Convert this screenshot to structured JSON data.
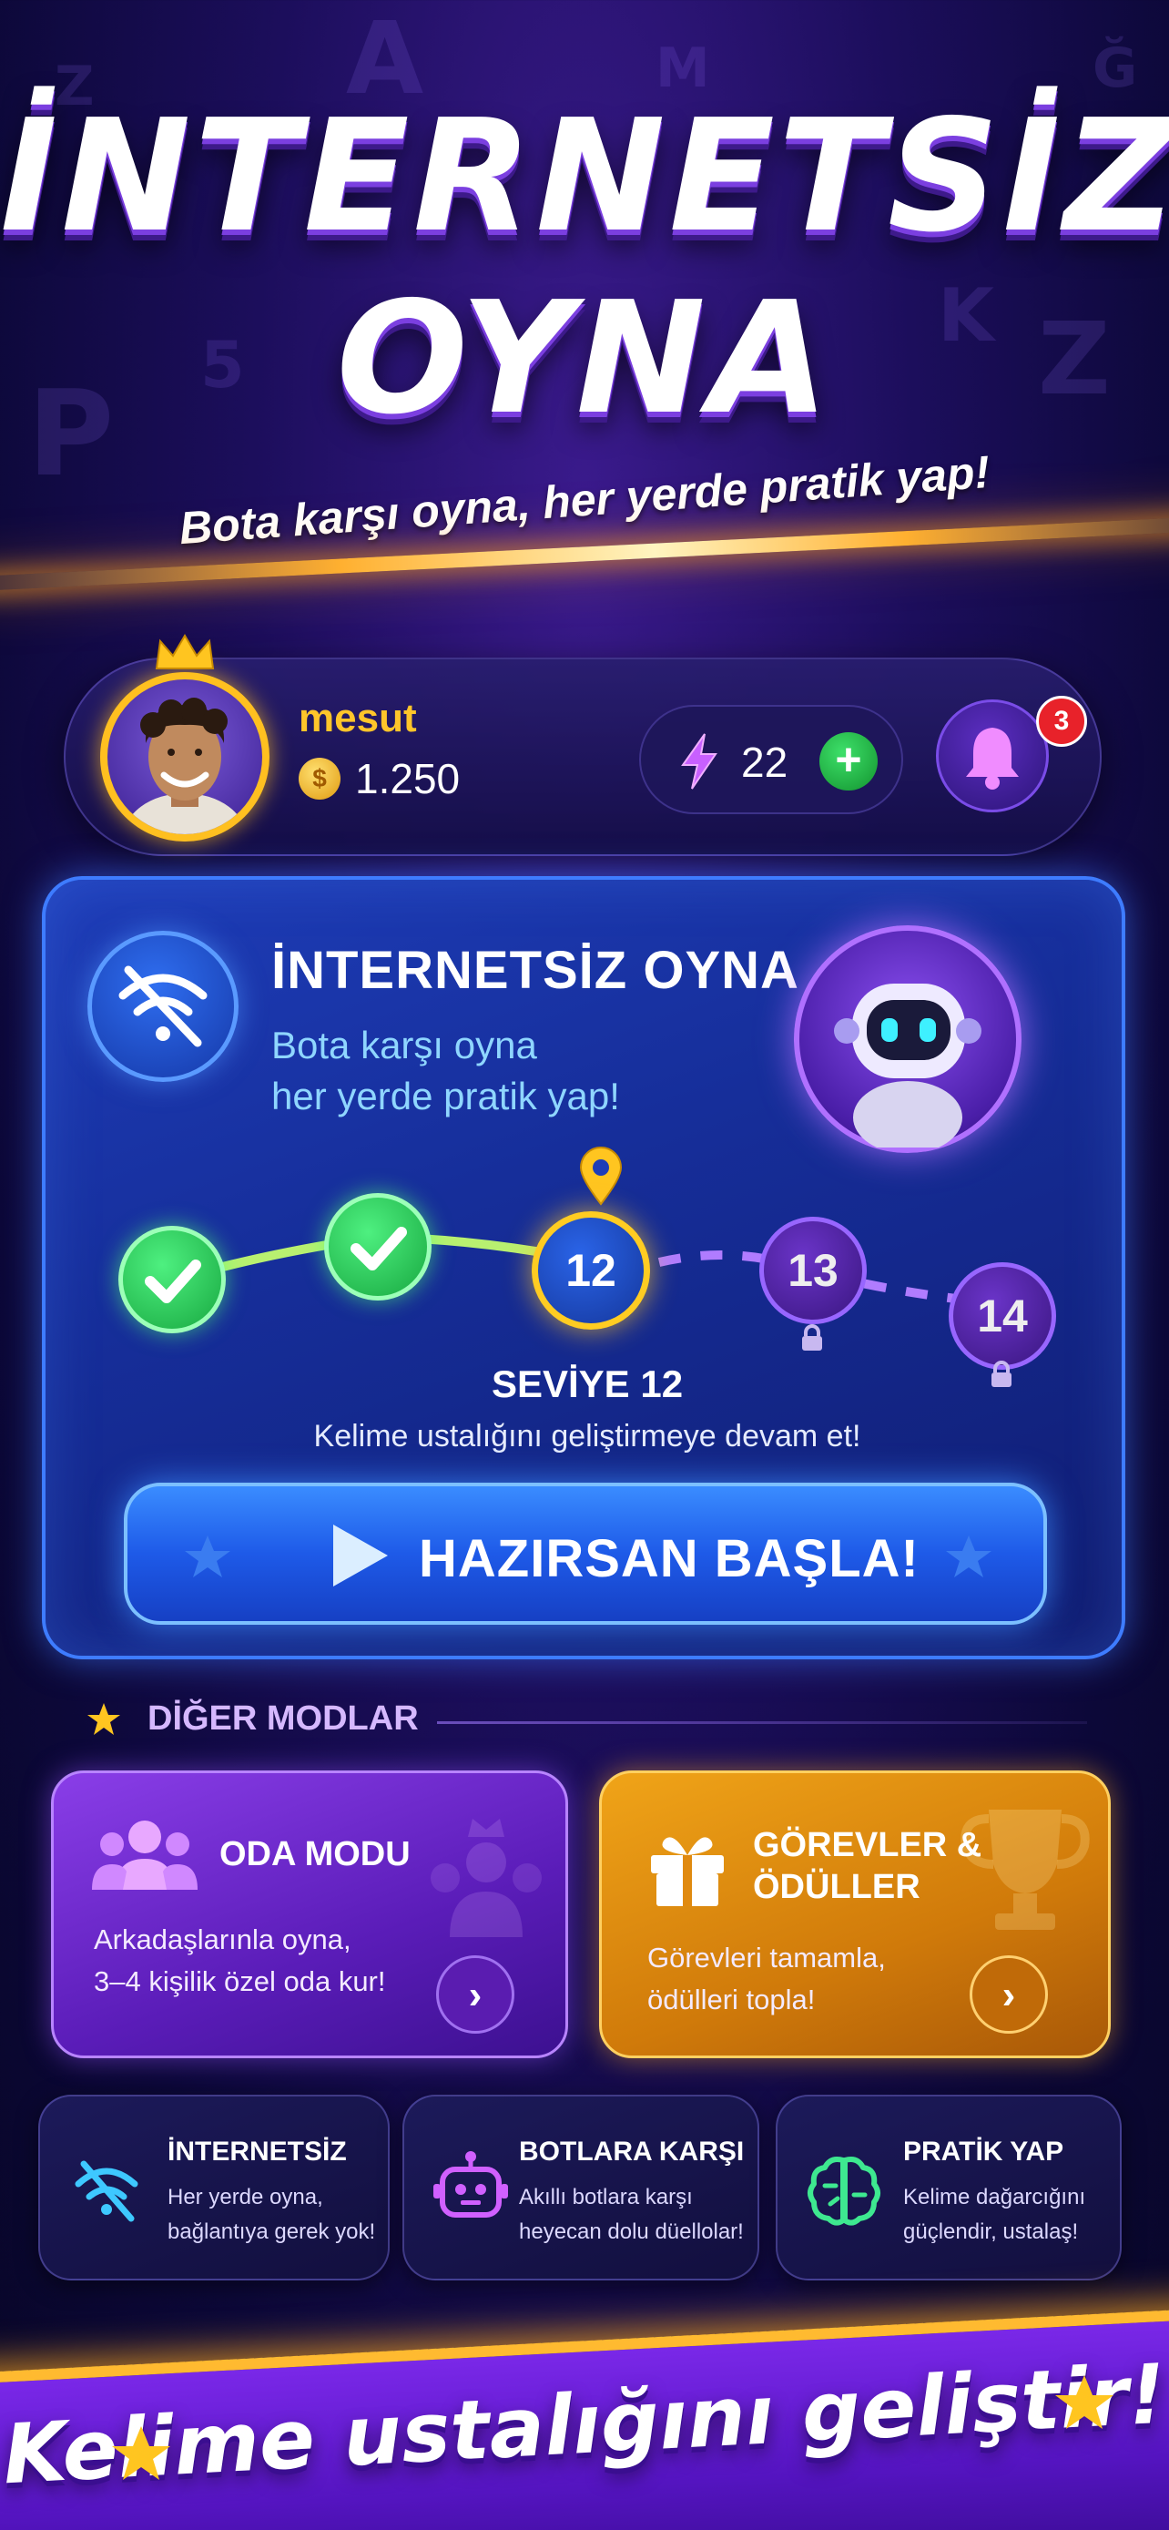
{
  "hero": {
    "title_line1": "İNTERNETSİZ",
    "title_line2": "OYNA",
    "subtitle": "Bota karşı oyna, her yerde pratik yap!"
  },
  "profile": {
    "username": "mesut",
    "coin_symbol": "$",
    "coins": "1.250",
    "energy": "22",
    "energy_add": "+",
    "notification_count": "3"
  },
  "offline_card": {
    "title": "İNTERNETSİZ OYNA",
    "subtitle_line1": "Bota karşı oyna",
    "subtitle_line2": "her yerde pratik yap!",
    "levels": [
      {
        "status": "completed",
        "label": ""
      },
      {
        "status": "completed",
        "label": ""
      },
      {
        "status": "current",
        "label": "12"
      },
      {
        "status": "locked",
        "label": "13"
      },
      {
        "status": "locked",
        "label": "14"
      }
    ],
    "level_title": "SEVİYE 12",
    "level_desc": "Kelime ustalığını geliştirmeye devam et!",
    "start_button": "HAZIRSAN BAŞLA!"
  },
  "other_modes": {
    "section_title": "DİĞER MODLAR",
    "room": {
      "title": "ODA MODU",
      "desc_line1": "Arkadaşlarınla oyna,",
      "desc_line2": "3–4 kişilik özel oda kur!",
      "arrow": "›"
    },
    "tasks": {
      "title_line1": "GÖREVLER &",
      "title_line2": "ÖDÜLLER",
      "desc_line1": "Görevleri tamamla,",
      "desc_line2": "ödülleri topla!",
      "arrow": "›"
    },
    "features": [
      {
        "title": "İNTERNETSİZ",
        "desc_line1": "Her yerde oyna,",
        "desc_line2": "bağlantıya gerek yok!",
        "icon": "wifi-off-icon"
      },
      {
        "title": "BOTLARA KARŞI",
        "desc_line1": "Akıllı botlara karşı",
        "desc_line2": "heyecan dolu düellolar!",
        "icon": "robot-icon"
      },
      {
        "title": "PRATİK YAP",
        "desc_line1": "Kelime dağarcığını",
        "desc_line2": "güçlendir, ustalaş!",
        "icon": "brain-icon"
      }
    ]
  },
  "footer": {
    "slogan": "Kelime ustalığını geliştir!"
  },
  "colors": {
    "accent_gold": "#ffc52a",
    "card_blue": "#1e3db8",
    "room_purple": "#8a3ee8",
    "tasks_orange": "#f0a418",
    "success_green": "#18a840"
  }
}
